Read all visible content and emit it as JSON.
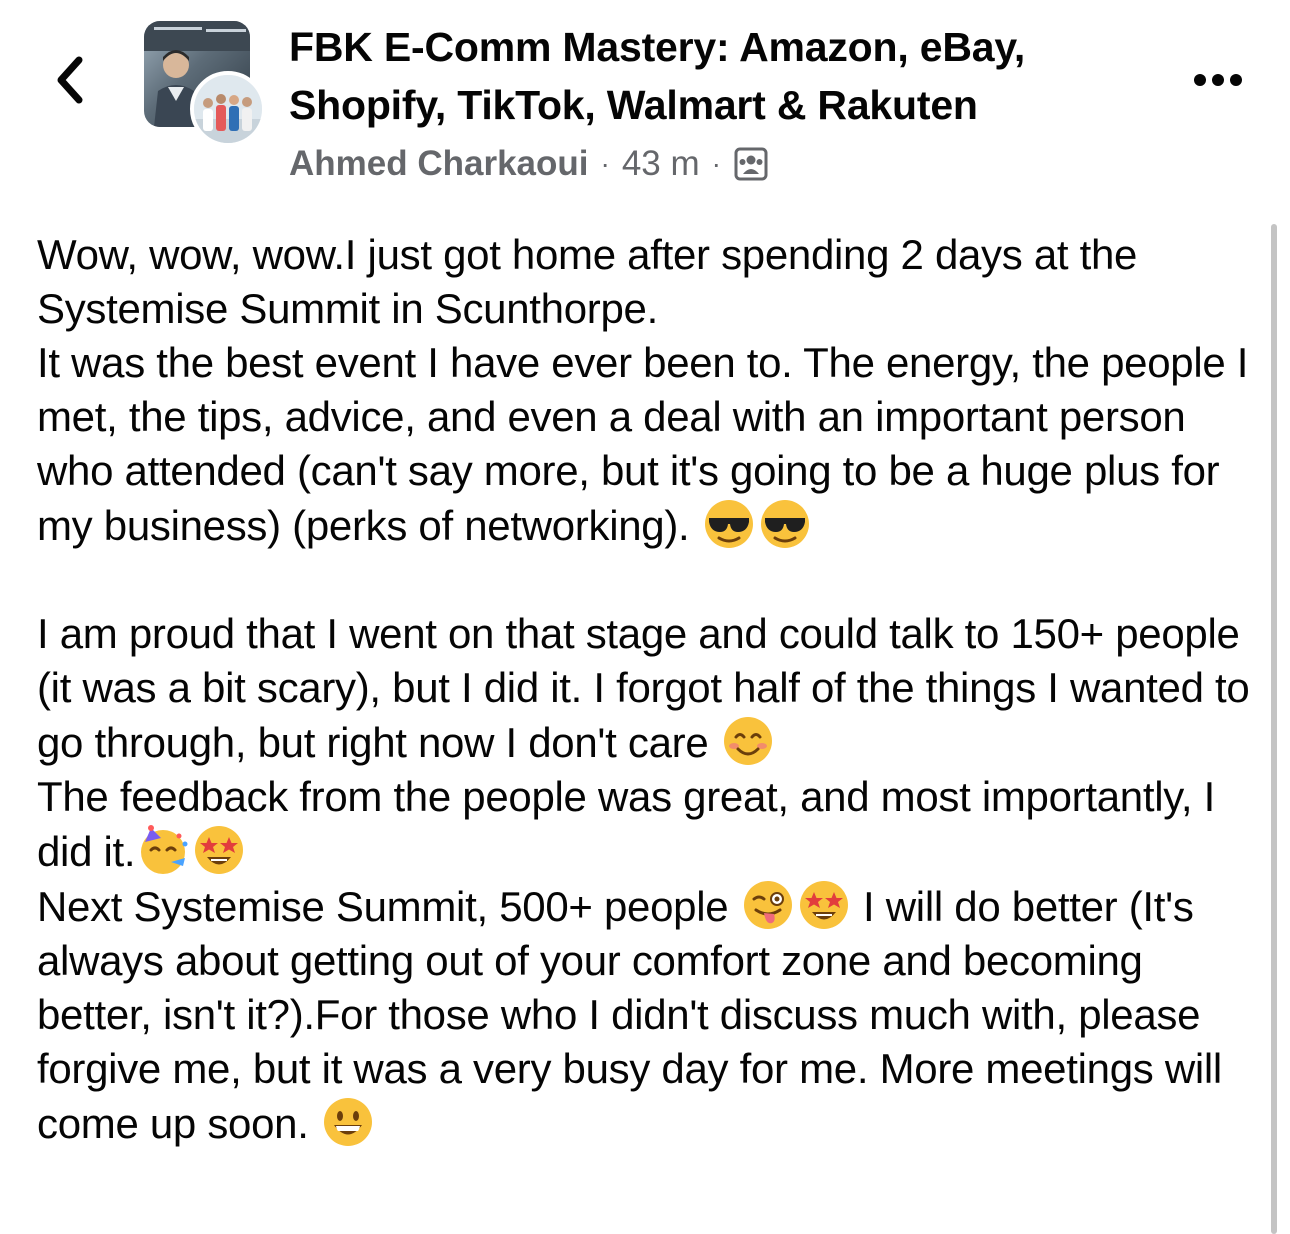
{
  "header": {
    "back_icon": "chevron-left-icon",
    "group_name": "FBK E-Comm Mastery: Amazon, eBay, Shopify, TikTok, Walmart & Rakuten",
    "author": "Ahmed Charkaoui",
    "time": "43 m",
    "separator": "·",
    "audience_icon": "group-members-icon",
    "more_icon": "more-horizontal-icon"
  },
  "post": {
    "p1_text": "Wow, wow, wow.I just got home after spending 2 days at the Systemise Summit in Scunthorpe.\nIt was the best event I have ever been to. The energy, the people I met, the tips, advice, and even a deal with an important person who attended (can't say more, but it's going to be a huge plus for my business) (perks of networking). ",
    "p2_a": "I am proud that I went on that stage and could talk to 150+ people (it was a bit scary), but I did it. I forgot half of the things I wanted to go through, but right now I don't care ",
    "p2_b": "\nThe feedback from the people was great, and most importantly, I did it.",
    "p3_a": "\nNext Systemise Summit, 500+ people ",
    "p3_b": " I will do better (It's always about getting out of your comfort zone and becoming better, isn't it?).For those who I didn't discuss much with, please forgive me, but it was a very busy day for me. More meetings will come up soon. ",
    "emojis": {
      "e1": "sunglasses-emoji",
      "e2": "sunglasses-emoji",
      "e3": "smiling-blush-emoji",
      "e4": "partying-face-emoji",
      "e5": "star-struck-emoji",
      "e6": "winking-tongue-emoji",
      "e7": "star-struck-emoji",
      "e8": "grinning-emoji"
    }
  }
}
